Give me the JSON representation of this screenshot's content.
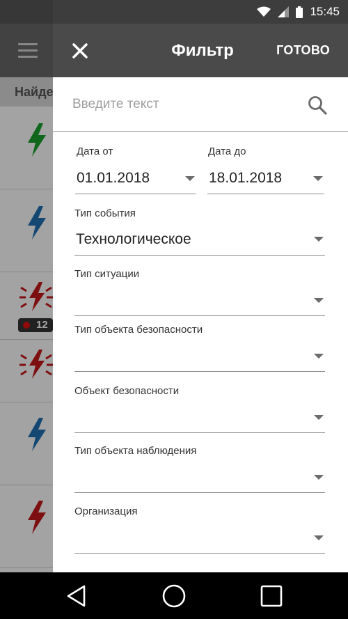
{
  "status_bar": {
    "time": "15:45"
  },
  "background": {
    "found_label": "Найде",
    "badge_count": "12"
  },
  "toolbar": {
    "title": "Фильтр",
    "done_label": "ГОТОВО"
  },
  "search": {
    "placeholder": "Введите текст"
  },
  "filters": {
    "date_from": {
      "label": "Дата от",
      "value": "01.01.2018"
    },
    "date_to": {
      "label": "Дата до",
      "value": "18.01.2018"
    },
    "event_type": {
      "label": "Тип события",
      "value": "Технологическое"
    },
    "situation_type": {
      "label": "Тип ситуации",
      "value": ""
    },
    "security_object_type": {
      "label": "Тип объекта безопасности",
      "value": ""
    },
    "security_object": {
      "label": "Объект безопасности",
      "value": ""
    },
    "observation_object_type": {
      "label": "Тип объекта наблюдения",
      "value": ""
    },
    "organization": {
      "label": "Организация",
      "value": ""
    }
  },
  "colors": {
    "toolbar": "#4a4a4a",
    "status_bar": "#3d3d3d",
    "bolt_green": "#1a9e2a",
    "bolt_blue": "#1f6fb0",
    "bolt_red": "#c2181b"
  }
}
